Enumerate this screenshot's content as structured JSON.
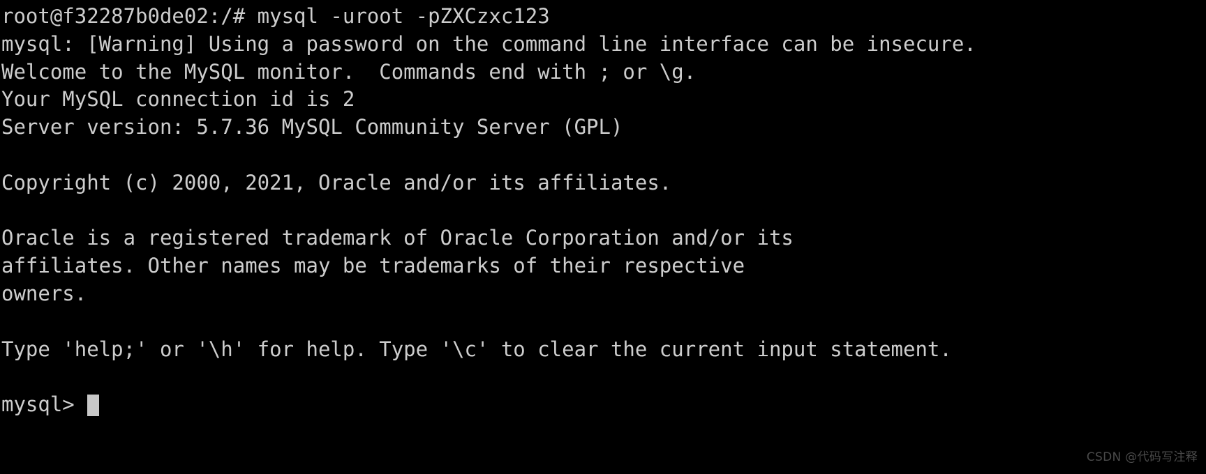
{
  "terminal": {
    "background_color": "#000000",
    "foreground_color": "#cdcdcd",
    "cursor_color": "#c8c8c8",
    "lines": [
      "root@f32287b0de02:/# mysql -uroot -pZXCzxc123",
      "mysql: [Warning] Using a password on the command line interface can be insecure.",
      "Welcome to the MySQL monitor.  Commands end with ; or \\g.",
      "Your MySQL connection id is 2",
      "Server version: 5.7.36 MySQL Community Server (GPL)",
      "",
      "Copyright (c) 2000, 2021, Oracle and/or its affiliates.",
      "",
      "Oracle is a registered trademark of Oracle Corporation and/or its",
      "affiliates. Other names may be trademarks of their respective",
      "owners.",
      "",
      "Type 'help;' or '\\h' for help. Type '\\c' to clear the current input statement.",
      ""
    ],
    "prompt": "mysql> ",
    "input_value": "",
    "cursor": "block-cursor"
  },
  "watermark": {
    "text": "CSDN @代码写注释",
    "color": "#4a4a4a"
  }
}
